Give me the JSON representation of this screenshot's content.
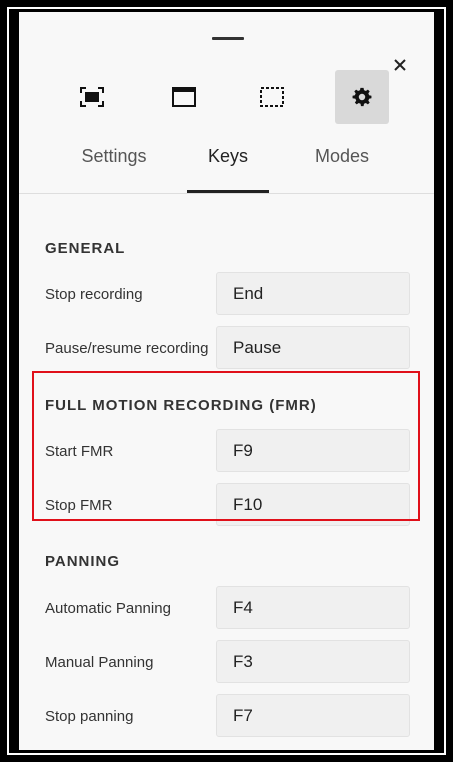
{
  "toolbar": {
    "modes": [
      {
        "name": "full-screen-icon"
      },
      {
        "name": "application-window-icon"
      },
      {
        "name": "custom-region-icon"
      },
      {
        "name": "settings-gear-icon"
      }
    ]
  },
  "tabs": [
    {
      "label": "Settings"
    },
    {
      "label": "Keys"
    },
    {
      "label": "Modes"
    }
  ],
  "sections": {
    "general": {
      "title": "GENERAL",
      "rows": [
        {
          "label": "Stop recording",
          "key": "End"
        },
        {
          "label": "Pause/resume recording",
          "key": "Pause"
        }
      ]
    },
    "fmr": {
      "title": "FULL MOTION RECORDING (FMR)",
      "rows": [
        {
          "label": "Start FMR",
          "key": "F9"
        },
        {
          "label": "Stop FMR",
          "key": "F10"
        }
      ]
    },
    "panning": {
      "title": "PANNING",
      "rows": [
        {
          "label": "Automatic Panning",
          "key": "F4"
        },
        {
          "label": "Manual Panning",
          "key": "F3"
        },
        {
          "label": "Stop panning",
          "key": "F7"
        }
      ]
    }
  },
  "colors": {
    "highlight": "#e0101a",
    "active_mode_bg": "#d9d9d9",
    "panel_bg": "#f8f8f8"
  }
}
